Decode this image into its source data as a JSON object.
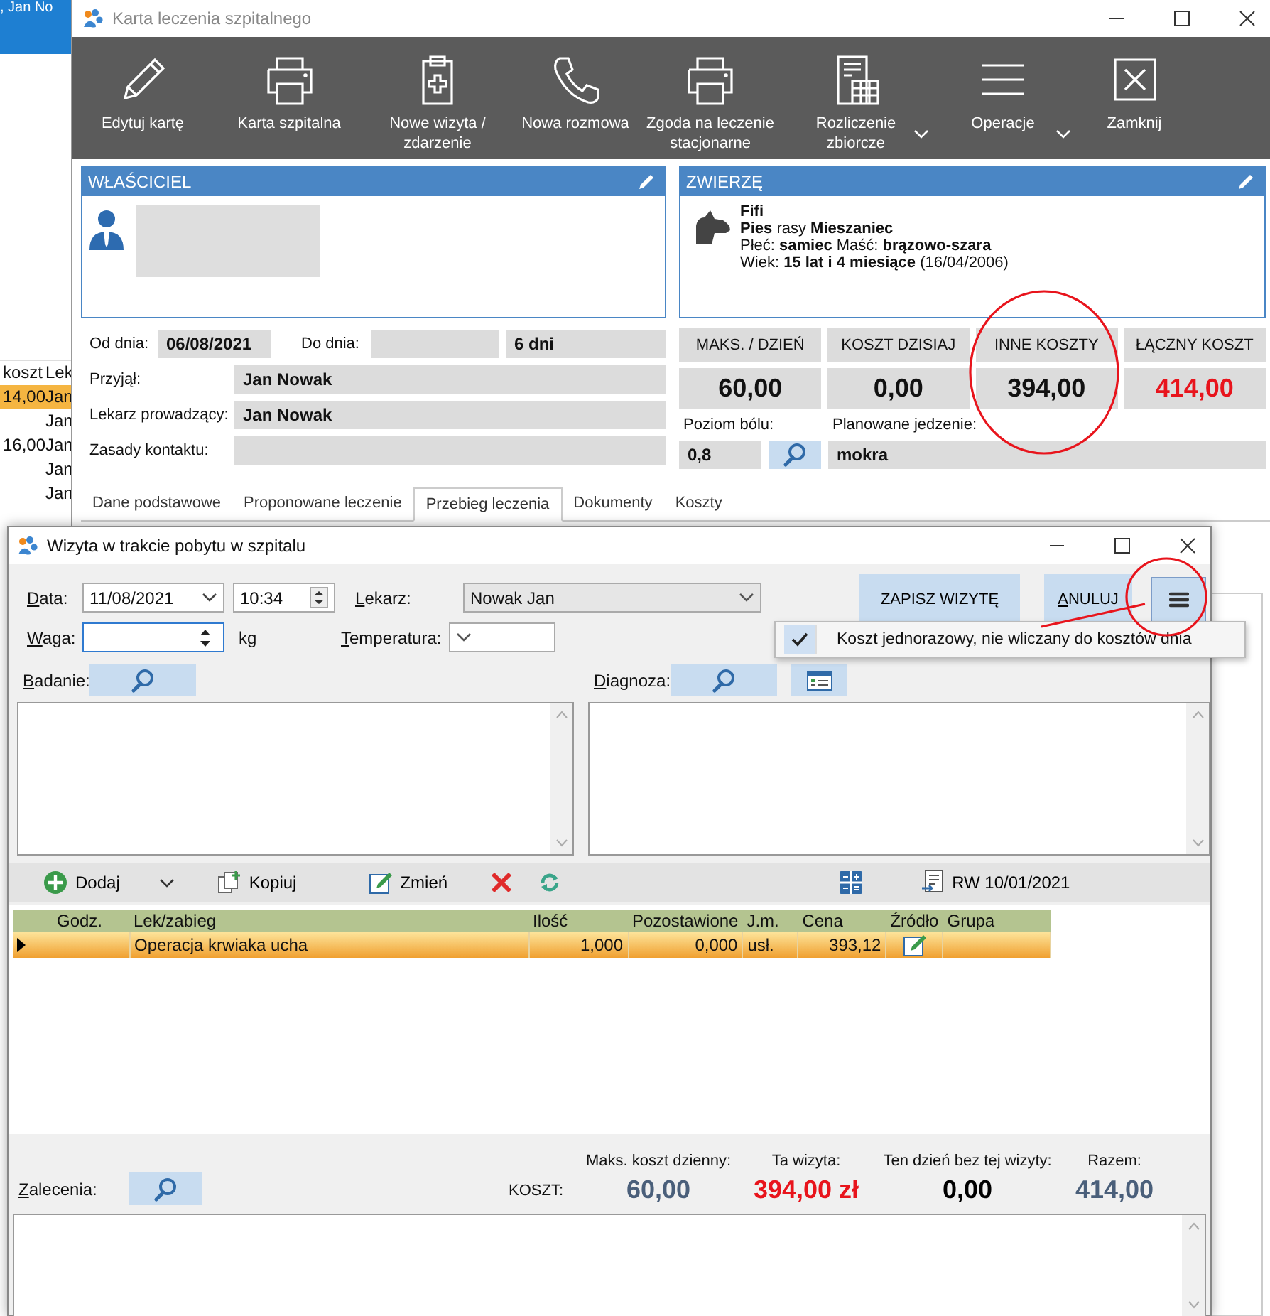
{
  "background_window": {
    "title_fragment": ", Jan No",
    "columns": [
      "koszt",
      "Lek"
    ],
    "rows": [
      {
        "column_1": "14,00",
        "column_2": "Jan",
        "selected": true
      },
      {
        "column_2": "Jan",
        "selected": false
      },
      {
        "column_1": "16,00",
        "column_2": "Jan",
        "selected": false
      },
      {
        "column_2": "Jan",
        "selected": false
      },
      {
        "column_2": "Jan",
        "selected": false
      }
    ]
  },
  "main_window": {
    "title": "Karta leczenia szpitalnego",
    "toolbar": [
      {
        "label": "Edytuj kartę",
        "kind": "pencil",
        "dropdown": false
      },
      {
        "label": "Karta szpitalna",
        "kind": "printer",
        "dropdown": false
      },
      {
        "label": "Nowe wizyta / zdarzenie",
        "kind": "clipboard",
        "dropdown": false
      },
      {
        "label": "Nowa rozmowa",
        "kind": "phone",
        "dropdown": false
      },
      {
        "label": "Zgoda na leczenie stacjonarne",
        "kind": "printer",
        "dropdown": false
      },
      {
        "label": "Rozliczenie zbiorcze",
        "kind": "calculator",
        "dropdown": true
      },
      {
        "label": "Operacje",
        "kind": "menu",
        "dropdown": true
      },
      {
        "label": "Zamknij",
        "kind": "close",
        "dropdown": false
      }
    ],
    "owner_panel": {
      "title": "WŁAŚCICIEL"
    },
    "animal_panel": {
      "title": "ZWIERZĘ",
      "name": "Fifi",
      "lines": [
        "**Pies** rasy **Mieszaniec**",
        "Płeć: **samiec**  Maść: **brązowo-szara**",
        "Wiek: **15 lat i 4 miesiące** (16/04/2006)"
      ]
    },
    "stay": {
      "from_label": "Od dnia:",
      "from": "06/08/2021",
      "to_label": "Do dnia:",
      "duration": "6 dni"
    },
    "fields": [
      {
        "label": "Przyjął:",
        "value": "Jan Nowak"
      },
      {
        "label": "Lekarz prowadzący:",
        "value": "Jan Nowak"
      },
      {
        "label": "Zasady kontaktu:"
      }
    ],
    "costs": [
      {
        "label": "MAKS. / DZIEŃ",
        "value": "60,00",
        "warning": false
      },
      {
        "label": "KOSZT DZISIAJ",
        "value": "0,00",
        "warning": false
      },
      {
        "label": "INNE KOSZTY",
        "value": "394,00",
        "warning": false
      },
      {
        "label": "ŁĄCZNY KOSZT",
        "value": "414,00",
        "warning": true
      }
    ],
    "pain": {
      "label": "Poziom bólu:",
      "value": "0,8"
    },
    "food": {
      "label": "Planowane jedzenie:",
      "value": "mokra"
    },
    "tabs": [
      {
        "label": "Dane podstawowe",
        "selected": false
      },
      {
        "label": "Proponowane leczenie",
        "selected": false
      },
      {
        "label": "Przebieg leczenia",
        "selected": true
      },
      {
        "label": "Dokumenty",
        "selected": false
      },
      {
        "label": "Koszty",
        "selected": false
      }
    ]
  },
  "dialog": {
    "title": "Wizyta w trakcie pobytu w szpitalu",
    "date_label": "Data:",
    "date": "11/08/2021",
    "time": "10:34",
    "doctor_label": "Lekarz:",
    "doctor": "Nowak Jan",
    "weight_label": "Waga:",
    "weight_unit": "kg",
    "temperature_label": "Temperatura:",
    "buttons": [
      "ZAPISZ WIZYTĘ",
      "ANULUJ"
    ],
    "menu": [
      {
        "label": "Koszt jednorazowy, nie wliczany do kosztów dnia",
        "checked": true
      }
    ],
    "exam_label": "Badanie:",
    "diagnosis_label": "Diagnoza:",
    "actions": [
      {
        "kind": "add",
        "label": "Dodaj"
      },
      {
        "kind": "dropdown"
      },
      {
        "kind": "copy",
        "label": "Kopiuj"
      },
      {
        "kind": "edit",
        "label": "Zmień"
      },
      {
        "kind": "delete"
      },
      {
        "kind": "refresh"
      },
      {
        "kind": "grid"
      },
      {
        "kind": "document",
        "label": "RW 10/01/2021"
      }
    ],
    "table": {
      "columns": [
        "Godz.",
        "Lek/zabieg",
        "Ilość",
        "Pozostawione",
        "J.m.",
        "Cena",
        "Źródło",
        "Grupa"
      ],
      "rows": [
        {
          "treatment": "Operacja krwiaka ucha",
          "quantity": "1,000",
          "remaining": "0,000",
          "unit": "usł.",
          "price": "393,12",
          "selected": true
        }
      ]
    },
    "recommendations_label": "Zalecenia:",
    "cost_label": "KOSZT:",
    "summary": [
      {
        "label": "Maks. koszt dzienny:",
        "value": "60,00",
        "color": "#4a5f7a"
      },
      {
        "label": "Ta wizyta:",
        "value": "394,00 zł",
        "color": "#e8141c"
      },
      {
        "label": "Ten dzień bez tej wizyty:",
        "value": "0,00",
        "color": "#000000"
      },
      {
        "label": "Razem:",
        "value": "414,00",
        "color": "#4a5f7a"
      }
    ]
  },
  "annotations": [
    {
      "kind": "ellipse"
    },
    {
      "kind": "ellipse"
    },
    {
      "kind": "line"
    }
  ]
}
